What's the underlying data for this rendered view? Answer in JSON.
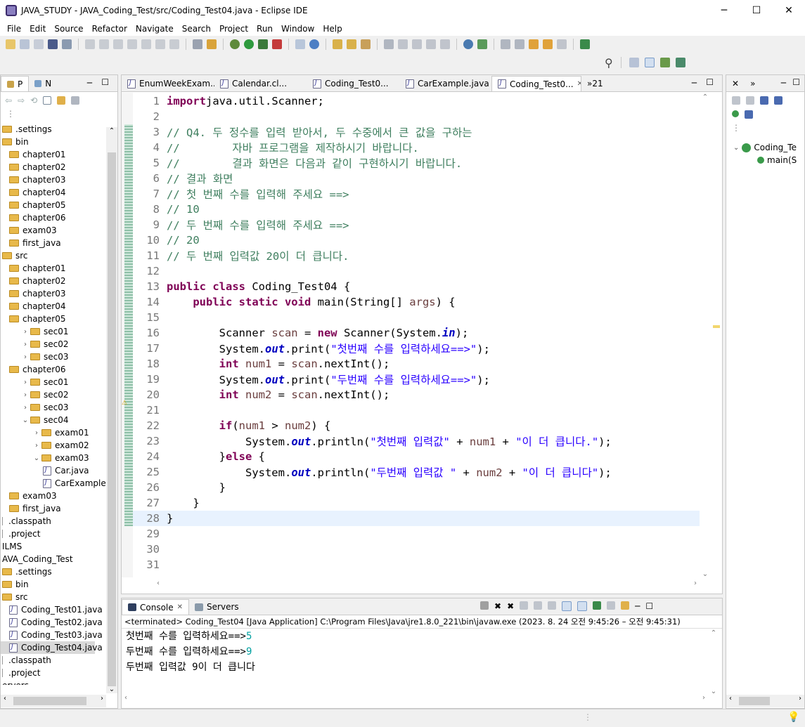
{
  "window": {
    "title": "JAVA_STUDY - JAVA_Coding_Test/src/Coding_Test04.java - Eclipse IDE",
    "minimize": "─",
    "maximize": "☐",
    "close": "✕"
  },
  "menu": [
    "File",
    "Edit",
    "Source",
    "Refactor",
    "Navigate",
    "Search",
    "Project",
    "Run",
    "Window",
    "Help"
  ],
  "explorer": {
    "tab1": "P",
    "tab2": "N",
    "rows": [
      {
        "label": ".settings",
        "indent": 0,
        "type": "folder"
      },
      {
        "label": "bin",
        "indent": 0,
        "type": "folder"
      },
      {
        "label": "chapter01",
        "indent": 1,
        "type": "folder"
      },
      {
        "label": "chapter02",
        "indent": 1,
        "type": "folder"
      },
      {
        "label": "chapter03",
        "indent": 1,
        "type": "folder"
      },
      {
        "label": "chapter04",
        "indent": 1,
        "type": "folder"
      },
      {
        "label": "chapter05",
        "indent": 1,
        "type": "folder"
      },
      {
        "label": "chapter06",
        "indent": 1,
        "type": "folder"
      },
      {
        "label": "exam03",
        "indent": 1,
        "type": "folder"
      },
      {
        "label": "first_java",
        "indent": 1,
        "type": "folder"
      },
      {
        "label": "src",
        "indent": 0,
        "type": "folder"
      },
      {
        "label": "chapter01",
        "indent": 1,
        "type": "folder"
      },
      {
        "label": "chapter02",
        "indent": 1,
        "type": "folder"
      },
      {
        "label": "chapter03",
        "indent": 1,
        "type": "folder"
      },
      {
        "label": "chapter04",
        "indent": 1,
        "type": "folder"
      },
      {
        "label": "chapter05",
        "indent": 1,
        "type": "folder"
      },
      {
        "label": "sec01",
        "indent": 2,
        "type": "folder",
        "caret": "›"
      },
      {
        "label": "sec02",
        "indent": 2,
        "type": "folder",
        "caret": "›"
      },
      {
        "label": "sec03",
        "indent": 2,
        "type": "folder",
        "caret": "›"
      },
      {
        "label": "chapter06",
        "indent": 1,
        "type": "folder"
      },
      {
        "label": "sec01",
        "indent": 2,
        "type": "folder",
        "caret": "›"
      },
      {
        "label": "sec02",
        "indent": 2,
        "type": "folder",
        "caret": "›"
      },
      {
        "label": "sec03",
        "indent": 2,
        "type": "folder",
        "caret": "›"
      },
      {
        "label": "sec04",
        "indent": 2,
        "type": "folder",
        "caret": "⌄"
      },
      {
        "label": "exam01",
        "indent": 3,
        "type": "folder",
        "caret": "›"
      },
      {
        "label": "exam02",
        "indent": 3,
        "type": "folder",
        "caret": "›"
      },
      {
        "label": "exam03",
        "indent": 3,
        "type": "folder",
        "caret": "⌄"
      },
      {
        "label": "Car.java",
        "indent": 4,
        "type": "file"
      },
      {
        "label": "CarExample.ja",
        "indent": 4,
        "type": "file"
      },
      {
        "label": "exam03",
        "indent": 1,
        "type": "folder"
      },
      {
        "label": "first_java",
        "indent": 1,
        "type": "folder"
      },
      {
        "label": ".classpath",
        "indent": 0,
        "type": "plain"
      },
      {
        "label": ".project",
        "indent": 0,
        "type": "plain"
      },
      {
        "label": "ILMS",
        "indent": -1,
        "type": "plain"
      },
      {
        "label": "AVA_Coding_Test",
        "indent": -1,
        "type": "plain"
      },
      {
        "label": ".settings",
        "indent": 0,
        "type": "folder"
      },
      {
        "label": "bin",
        "indent": 0,
        "type": "folder"
      },
      {
        "label": "src",
        "indent": 0,
        "type": "folder"
      },
      {
        "label": "Coding_Test01.java",
        "indent": 1,
        "type": "file"
      },
      {
        "label": "Coding_Test02.java",
        "indent": 1,
        "type": "file"
      },
      {
        "label": "Coding_Test03.java",
        "indent": 1,
        "type": "file"
      },
      {
        "label": "Coding_Test04.java",
        "indent": 1,
        "type": "file",
        "selected": true
      },
      {
        "label": ".classpath",
        "indent": 0,
        "type": "plain"
      },
      {
        "label": ".project",
        "indent": 0,
        "type": "plain"
      },
      {
        "label": "ervers",
        "indent": -1,
        "type": "plain"
      }
    ]
  },
  "editor_tabs": [
    {
      "label": "EnumWeekExam...",
      "active": false
    },
    {
      "label": "Calendar.cl...",
      "active": false
    },
    {
      "label": "Coding_Test0...",
      "active": false
    },
    {
      "label": "CarExample.java",
      "active": false
    },
    {
      "label": "Coding_Test0...",
      "active": true
    }
  ],
  "editor_overflow": "»21",
  "code_lines": [
    [
      [
        "kw",
        "import"
      ],
      [
        "",
        "java.util.Scanner;"
      ]
    ],
    [],
    [
      [
        "cm",
        "// Q4. 두 정수를 입력 받아서, 두 수중에서 큰 값을 구하는"
      ]
    ],
    [
      [
        "cm",
        "//        자바 프로그램을 제작하시기 바랍니다."
      ]
    ],
    [
      [
        "cm",
        "//        결과 화면은 다음과 같이 구현하시기 바랍니다."
      ]
    ],
    [
      [
        "cm",
        "// 결과 화면"
      ]
    ],
    [
      [
        "cm",
        "// 첫 번째 수를 입력해 주세요 ==>"
      ]
    ],
    [
      [
        "cm",
        "// 10"
      ]
    ],
    [
      [
        "cm",
        "// 두 번째 수를 입력해 주세요 ==>"
      ]
    ],
    [
      [
        "cm",
        "// 20"
      ]
    ],
    [
      [
        "cm",
        "// 두 번째 입력값 20이 더 큽니다."
      ]
    ],
    [],
    [
      [
        "kw",
        "public class"
      ],
      [
        "",
        " Coding_Test04 {"
      ]
    ],
    [
      [
        "",
        "    "
      ],
      [
        "kw",
        "public static void"
      ],
      [
        "",
        " main(String[] "
      ],
      [
        "var",
        "args"
      ],
      [
        "",
        ") {"
      ]
    ],
    [],
    [
      [
        "",
        "        Scanner "
      ],
      [
        "var",
        "scan"
      ],
      [
        "",
        " = "
      ],
      [
        "kw",
        "new"
      ],
      [
        "",
        " Scanner(System."
      ],
      [
        "fld",
        "in"
      ],
      [
        "",
        ");"
      ]
    ],
    [
      [
        "",
        "        System."
      ],
      [
        "fld",
        "out"
      ],
      [
        "",
        ".print("
      ],
      [
        "st",
        "\"첫번째 수를 입력하세요==>\""
      ],
      [
        "",
        ");"
      ]
    ],
    [
      [
        "",
        "        "
      ],
      [
        "kw",
        "int"
      ],
      [
        "",
        " "
      ],
      [
        "var",
        "num1"
      ],
      [
        "",
        " = "
      ],
      [
        "var",
        "scan"
      ],
      [
        "",
        ".nextInt();"
      ]
    ],
    [
      [
        "",
        "        System."
      ],
      [
        "fld",
        "out"
      ],
      [
        "",
        ".print("
      ],
      [
        "st",
        "\"두번째 수를 입력하세요==>\""
      ],
      [
        "",
        ");"
      ]
    ],
    [
      [
        "",
        "        "
      ],
      [
        "kw",
        "int"
      ],
      [
        "",
        " "
      ],
      [
        "var",
        "num2"
      ],
      [
        "",
        " = "
      ],
      [
        "var",
        "scan"
      ],
      [
        "",
        ".nextInt();"
      ]
    ],
    [],
    [
      [
        "",
        "        "
      ],
      [
        "kw",
        "if"
      ],
      [
        "",
        "("
      ],
      [
        "var",
        "num1"
      ],
      [
        "",
        " > "
      ],
      [
        "var",
        "num2"
      ],
      [
        "",
        ") {"
      ]
    ],
    [
      [
        "",
        "            System."
      ],
      [
        "fld",
        "out"
      ],
      [
        "",
        ".println("
      ],
      [
        "st",
        "\"첫번째 입력값\""
      ],
      [
        "",
        " + "
      ],
      [
        "var",
        "num1"
      ],
      [
        "",
        " + "
      ],
      [
        "st",
        "\"이 더 큽니다.\""
      ],
      [
        "",
        ");"
      ]
    ],
    [
      [
        "",
        "        }"
      ],
      [
        "kw",
        "else"
      ],
      [
        "",
        " {"
      ]
    ],
    [
      [
        "",
        "            System."
      ],
      [
        "fld",
        "out"
      ],
      [
        "",
        ".println("
      ],
      [
        "st",
        "\"두번째 입력값 \""
      ],
      [
        "",
        " + "
      ],
      [
        "var",
        "num2"
      ],
      [
        "",
        " + "
      ],
      [
        "st",
        "\"이 더 큽니다\""
      ],
      [
        "",
        ");"
      ]
    ],
    [
      [
        "",
        "        }"
      ]
    ],
    [
      [
        "",
        "    }"
      ]
    ],
    [
      [
        "",
        "}"
      ]
    ],
    [],
    [],
    []
  ],
  "console": {
    "tab_console": "Console",
    "tab_servers": "Servers",
    "header": "<terminated> Coding_Test04 [Java Application] C:\\Program Files\\Java\\jre1.8.0_221\\bin\\javaw.exe  (2023. 8. 24 오전 9:45:26 – 오전 9:45:31)",
    "lines": [
      {
        "prompt": "첫번째 수를 입력하세요==>",
        "input": "5"
      },
      {
        "prompt": "두번째 수를 입력하세요==>",
        "input": "9"
      },
      {
        "prompt": "두번째 입력값 9이 더 큽니다",
        "input": ""
      }
    ]
  },
  "outline": {
    "class_label": "Coding_Te",
    "method_label": "main(S"
  },
  "colors": {
    "keyword": "#7f0055",
    "comment": "#3f7f5f",
    "string": "#2a00ff",
    "field": "#0000c0",
    "current_line": "#e8f2fe"
  }
}
